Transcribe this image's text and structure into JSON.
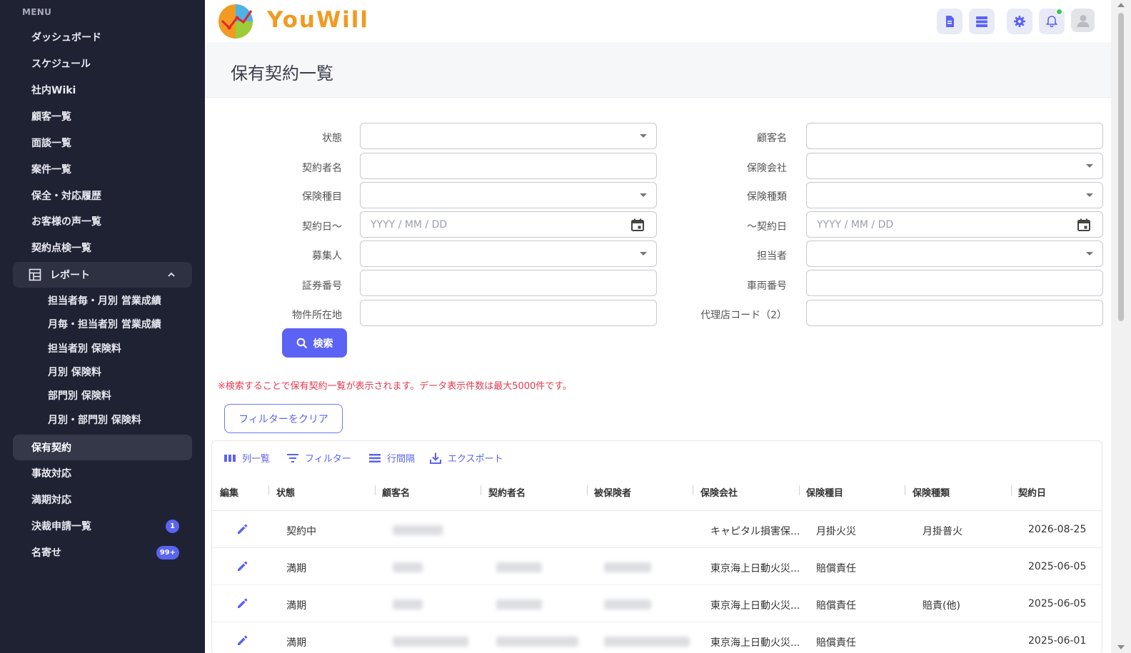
{
  "sidebar": {
    "menu_label": "MENU",
    "items": [
      {
        "label": "ダッシュボード"
      },
      {
        "label": "スケジュール"
      },
      {
        "label": "社内Wiki"
      },
      {
        "label": "顧客一覧"
      },
      {
        "label": "面談一覧"
      },
      {
        "label": "案件一覧"
      },
      {
        "label": "保全・対応履歴"
      },
      {
        "label": "お客様の声一覧"
      },
      {
        "label": "契約点検一覧"
      }
    ],
    "report_group": {
      "label": "レポート",
      "icon": "report-table-icon",
      "expanded": true,
      "sub_items": [
        {
          "label": "担当者毎・月別 営業成績"
        },
        {
          "label": "月毎・担当者別 営業成績"
        },
        {
          "label": "担当者別 保険料"
        },
        {
          "label": "月別 保険料"
        },
        {
          "label": "部門別 保険料"
        },
        {
          "label": "月別・部門別 保険料"
        }
      ]
    },
    "bottom_items": [
      {
        "label": "保有契約",
        "active": true
      },
      {
        "label": "事故対応"
      },
      {
        "label": "満期対応"
      },
      {
        "label": "決裁申請一覧",
        "badge": "1"
      },
      {
        "label": "名寄せ",
        "badge": "99+"
      }
    ]
  },
  "header": {
    "logo_text": "YouWill",
    "buttons": [
      "document-icon",
      "list-icon",
      "gear-icon",
      "bell-icon",
      "avatar"
    ],
    "accent": "#5b63f5",
    "logo_color": "#f29a21",
    "notification_dot_color": "#3ac45a"
  },
  "page": {
    "title": "保有契約一覧"
  },
  "filters": {
    "left": [
      {
        "label": "状態",
        "type": "select",
        "value": ""
      },
      {
        "label": "契約者名",
        "type": "text",
        "value": ""
      },
      {
        "label": "保険種目",
        "type": "select",
        "value": ""
      },
      {
        "label": "契約日〜",
        "type": "date",
        "placeholder": "YYYY / MM / DD"
      },
      {
        "label": "募集人",
        "type": "select",
        "value": ""
      },
      {
        "label": "証券番号",
        "type": "text",
        "value": ""
      },
      {
        "label": "物件所在地",
        "type": "text",
        "value": ""
      }
    ],
    "right": [
      {
        "label": "顧客名",
        "type": "text",
        "value": ""
      },
      {
        "label": "保険会社",
        "type": "select",
        "value": ""
      },
      {
        "label": "保険種類",
        "type": "select",
        "value": ""
      },
      {
        "label": "〜契約日",
        "type": "date",
        "placeholder": "YYYY / MM / DD"
      },
      {
        "label": "担当者",
        "type": "select",
        "value": ""
      },
      {
        "label": "車両番号",
        "type": "text",
        "value": ""
      },
      {
        "label": "代理店コード（2）",
        "type": "text",
        "value": ""
      }
    ],
    "search_button": "検索",
    "notice": "※検索することで保有契約一覧が表示されます。データ表示件数は最大5000件です。",
    "notice_color": "#e23a4e",
    "clear_button": "フィルターをクリア"
  },
  "grid": {
    "toolbar": [
      {
        "label": "列一覧",
        "icon": "columns-icon"
      },
      {
        "label": "フィルター",
        "icon": "filter-icon"
      },
      {
        "label": "行間隔",
        "icon": "density-icon"
      },
      {
        "label": "エクスポート",
        "icon": "export-icon"
      }
    ],
    "columns": [
      "編集",
      "状態",
      "顧客名",
      "契約者名",
      "被保険者",
      "保険会社",
      "保険種目",
      "保険種類",
      "契約日"
    ],
    "rows": [
      {
        "status": "契約中",
        "company": "キャピタル損害保...",
        "category": "月掛火災",
        "type": "月掛普火",
        "date": "2026-08-25"
      },
      {
        "status": "満期",
        "company": "東京海上日動火災...",
        "category": "賠償責任",
        "type": "",
        "date": "2025-06-05"
      },
      {
        "status": "満期",
        "company": "東京海上日動火災...",
        "category": "賠償責任",
        "type": "賠責(他)",
        "date": "2025-06-05"
      },
      {
        "status": "満期",
        "company": "東京海上日動火災...",
        "category": "賠償責任",
        "type": "",
        "date": "2025-06-01"
      }
    ]
  }
}
